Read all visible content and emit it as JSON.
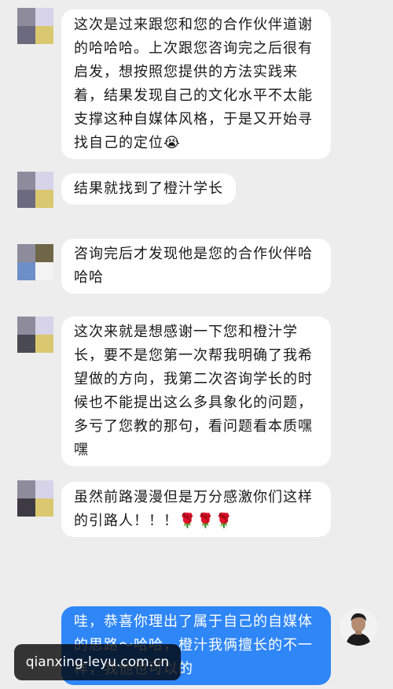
{
  "colors": {
    "background": "#ededed",
    "received_bubble": "#ffffff",
    "sent_bubble": "#2f86f6",
    "avatar_tiles": [
      "#8e8c9c",
      "#d7d3e8",
      "#6b6a7e",
      "#d9c86f"
    ]
  },
  "messages": [
    {
      "side": "received",
      "lines": [
        "这次是过来跟您和您的合作伙伴道谢",
        "的哈哈哈。上次跟您咨询完之后很有",
        "启发，想按照您提供的方法实践来",
        "着，结果发现自己的文化水平不太能",
        "支撑这种自媒体风格，于是又开始寻",
        "找自己的定位😭"
      ]
    },
    {
      "side": "received",
      "lines": [
        "结果就找到了橙汁学长"
      ]
    },
    {
      "side": "received",
      "lines": [
        "咨询完后才发现他是您的合作伙伴哈",
        "哈哈"
      ]
    },
    {
      "side": "received",
      "lines": [
        "这次来就是想感谢一下您和橙汁学",
        "长，要不是您第一次帮我明确了我希",
        "望做的方向，我第二次咨询学长的时",
        "候也不能提出这么多具象化的问题，",
        "多亏了您教的那句，看问题看本质嘿",
        "嘿"
      ]
    },
    {
      "side": "received",
      "lines": [
        "虽然前路漫漫但是万分感激你们这样",
        "的引路人！！！🌹🌹🌹"
      ]
    },
    {
      "side": "sent",
      "lines": [
        "哇，恭喜你理出了属于自己的自媒体",
        "的思路～哈哈，橙汁我俩擅长的不一",
        "样，我他也可以的"
      ]
    }
  ],
  "watermark": {
    "text": "qianxing-leyu.com.cn"
  }
}
